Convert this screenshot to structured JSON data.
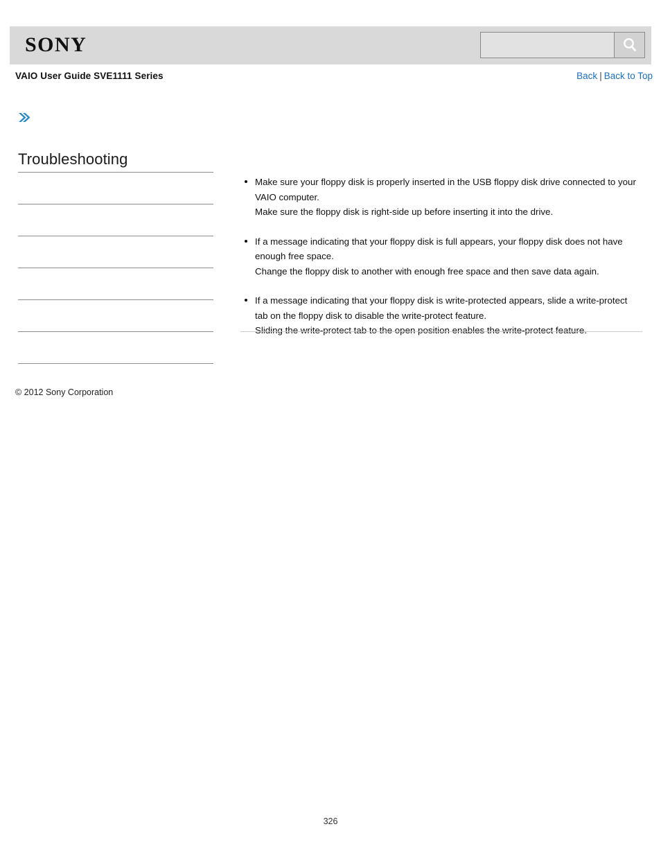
{
  "header": {
    "logo_text": "SONY",
    "search": {
      "value": "",
      "placeholder": "",
      "icon": "search-icon",
      "button_title": "Search"
    }
  },
  "subheader": {
    "guide_title": "VAIO User Guide SVE1111 Series",
    "links": {
      "back": "Back",
      "separator": "|",
      "back_to_top": "Back to Top"
    }
  },
  "breadcrumb_icon": "double-chevron-right-icon",
  "sidebar": {
    "title": "Troubleshooting",
    "entries": [
      "",
      "",
      "",
      "",
      "",
      ""
    ]
  },
  "main": {
    "bullets": [
      {
        "lines": [
          "Make sure your floppy disk is properly inserted in the USB floppy disk drive connected to your VAIO computer.",
          "Make sure the floppy disk is right-side up before inserting it into the drive."
        ]
      },
      {
        "lines": [
          "If a message indicating that your floppy disk is full appears, your floppy disk does not have enough free space.",
          "Change the floppy disk to another with enough free space and then save data again."
        ]
      },
      {
        "lines": [
          "If a message indicating that your floppy disk is write-protected appears, slide a write-protect tab on the floppy disk to disable the write-protect feature.",
          "Sliding the write-protect tab to the open position enables the write-protect feature."
        ]
      }
    ]
  },
  "footer": {
    "copyright": "© 2012 Sony Corporation",
    "page_number": "326"
  },
  "colors": {
    "header_band": "#d9d9d9",
    "link_blue": "#1a6fc4",
    "chevron_blue": "#2b8bc8",
    "rule_gray": "#8e8e8e",
    "content_rule_gray": "#cccccc"
  }
}
